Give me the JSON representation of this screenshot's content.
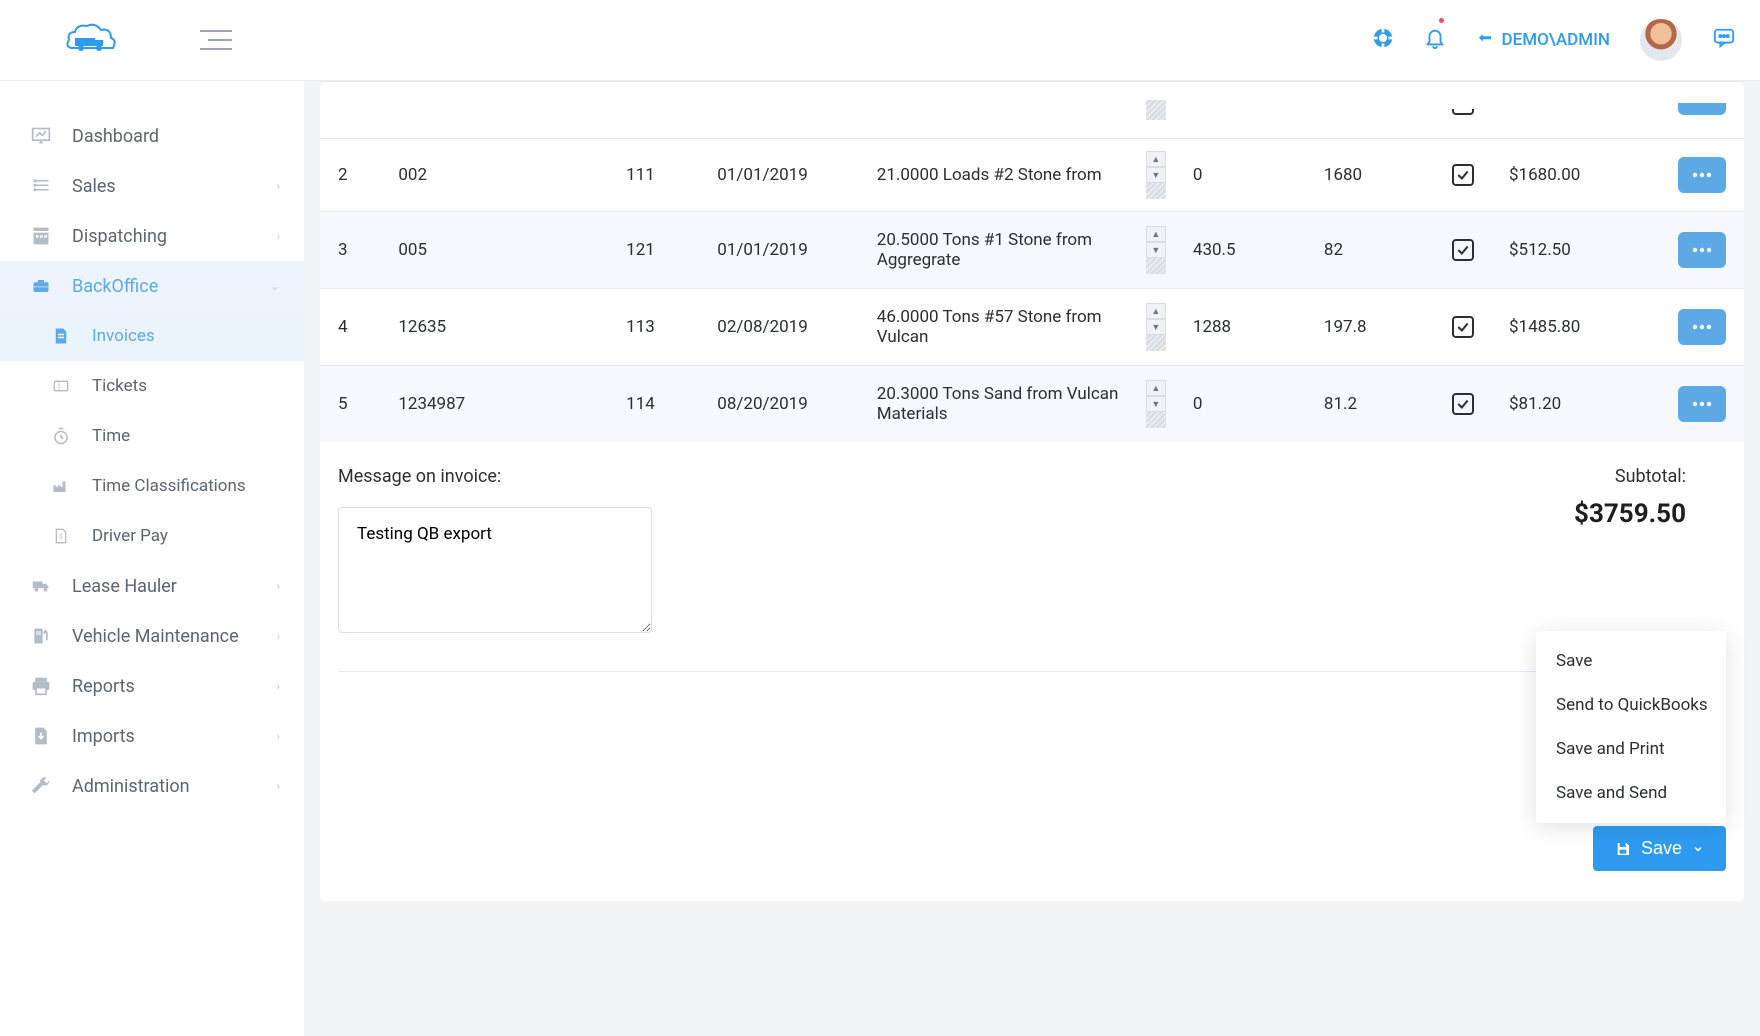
{
  "header": {
    "user_link_prefix": "DEMO",
    "user_link_separator": "\\",
    "user_link_name": "ADMIN"
  },
  "sidebar": {
    "items": [
      {
        "label": "Dashboard"
      },
      {
        "label": "Sales"
      },
      {
        "label": "Dispatching"
      },
      {
        "label": "BackOffice"
      },
      {
        "label": "Lease Hauler"
      },
      {
        "label": "Vehicle Maintenance"
      },
      {
        "label": "Reports"
      },
      {
        "label": "Imports"
      },
      {
        "label": "Administration"
      }
    ],
    "backoffice_sub": [
      {
        "label": "Invoices"
      },
      {
        "label": "Tickets"
      },
      {
        "label": "Time"
      },
      {
        "label": "Time Classifications"
      },
      {
        "label": "Driver Pay"
      }
    ]
  },
  "invoice": {
    "rows": [
      {
        "idx": "2",
        "num": "002",
        "c": "111",
        "date": "01/01/2019",
        "desc": "21.0000 Loads #2 Stone from",
        "v1": "0",
        "v2": "1680",
        "total": "$1680.00",
        "checked": true
      },
      {
        "idx": "3",
        "num": "005",
        "c": "121",
        "date": "01/01/2019",
        "desc": "20.5000 Tons #1 Stone from Aggregrate",
        "v1": "430.5",
        "v2": "82",
        "total": "$512.50",
        "checked": true
      },
      {
        "idx": "4",
        "num": "12635",
        "c": "113",
        "date": "02/08/2019",
        "desc": "46.0000 Tons #57 Stone from Vulcan",
        "v1": "1288",
        "v2": "197.8",
        "total": "$1485.80",
        "checked": true
      },
      {
        "idx": "5",
        "num": "1234987",
        "c": "114",
        "date": "08/20/2019",
        "desc": "20.3000 Tons Sand from Vulcan Materials",
        "v1": "0",
        "v2": "81.2",
        "total": "$81.20",
        "checked": true
      }
    ],
    "message_label": "Message on invoice:",
    "message_value": "Testing QB export",
    "subtotal_label": "Subtotal:",
    "subtotal_value": "$3759.50"
  },
  "save_menu": {
    "items": [
      {
        "label": "Save"
      },
      {
        "label": "Send to QuickBooks"
      },
      {
        "label": "Save and Print"
      },
      {
        "label": "Save and Send"
      }
    ],
    "button_label": "Save"
  }
}
